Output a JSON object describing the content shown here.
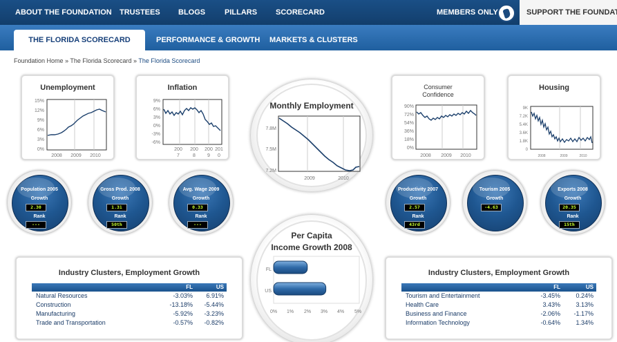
{
  "topnav": {
    "items": [
      "ABOUT THE FOUNDATION",
      "TRUSTEES",
      "BLOGS",
      "PILLARS",
      "SCORECARD"
    ],
    "members": "MEMBERS ONLY",
    "support": "SUPPORT THE FOUNDATION"
  },
  "subnav": {
    "tabs": [
      "THE FLORIDA SCORECARD",
      "PERFORMANCE & GROWTH",
      "MARKETS & CLUSTERS"
    ]
  },
  "breadcrumb": {
    "home": "Foundation Home",
    "sep": "»",
    "parent": "The Florida Scorecard",
    "current": "The Florida Scorecard"
  },
  "charts": {
    "unemployment": {
      "title": "Unemployment",
      "yticks": [
        "15%",
        "12%",
        "9%",
        "6%",
        "3%",
        "0%"
      ],
      "xticks": [
        "2008",
        "2009",
        "2010"
      ]
    },
    "inflation": {
      "title": "Inflation",
      "yticks": [
        "9%",
        "6%",
        "3%",
        "0%",
        "-3%",
        "-6%"
      ],
      "xticks": [
        [
          "200",
          "7"
        ],
        [
          "200",
          "8"
        ],
        [
          "200",
          "9"
        ],
        [
          "201",
          "0"
        ]
      ]
    },
    "monthly": {
      "title": "Monthly Employment",
      "yticks": [
        "7.8M",
        "7.5M",
        "7.2M"
      ],
      "xticks": [
        "2009",
        "2010"
      ]
    },
    "confidence": {
      "title_line1": "Consumer",
      "title_line2": "Confidence",
      "yticks": [
        "90%",
        "72%",
        "54%",
        "36%",
        "18%",
        "0%"
      ],
      "xticks": [
        "2008",
        "2009",
        "2010"
      ]
    },
    "housing": {
      "title": "Housing",
      "yticks": [
        "9K",
        "7.2K",
        "5.4K",
        "3.6K",
        "1.8K",
        "0"
      ],
      "xticks": [
        "2008",
        "2009",
        "2010"
      ]
    },
    "percapita": {
      "title_line1": "Per Capita",
      "title_line2": "Income Growth 2008",
      "categories": [
        "FL",
        "US"
      ],
      "values": [
        2.0,
        3.1
      ],
      "xticks": [
        "0%",
        "1%",
        "2%",
        "3%",
        "4%",
        "5%"
      ]
    }
  },
  "stats": [
    {
      "title": "Population 2005",
      "growth_label": "Growth",
      "growth": "2.30",
      "rank_label": "Rank",
      "rank": "---"
    },
    {
      "title": "Gross Prod. 2008",
      "growth_label": "Growth",
      "growth": "1.31",
      "rank_label": "Rank",
      "rank": "50th"
    },
    {
      "title": "Avg. Wage 2009",
      "growth_label": "Growth",
      "growth": "0.33",
      "rank_label": "Rank",
      "rank": "---"
    },
    {
      "title": "Productivity 2007",
      "growth_label": "Growth",
      "growth": "2.57",
      "rank_label": "Rank",
      "rank": "43rd"
    },
    {
      "title": "Tourism 2005",
      "growth_label": "Growth",
      "growth": "-4.63",
      "rank_label": "",
      "rank": ""
    },
    {
      "title": "Exports 2008",
      "growth_label": "Growth",
      "growth": "20.35",
      "rank_label": "Rank",
      "rank": "15th"
    }
  ],
  "clusters_left": {
    "title": "Industry Clusters, Employment Growth",
    "cols": [
      "FL",
      "US"
    ],
    "rows": [
      {
        "name": "Natural Resources",
        "fl": "-3.03%",
        "us": "6.91%"
      },
      {
        "name": "Construction",
        "fl": "-13.18%",
        "us": "-5.44%"
      },
      {
        "name": "Manufacturing",
        "fl": "-5.92%",
        "us": "-3.23%"
      },
      {
        "name": "Trade and Transportation",
        "fl": "-0.57%",
        "us": "-0.82%"
      }
    ]
  },
  "clusters_right": {
    "title": "Industry Clusters, Employment Growth",
    "cols": [
      "FL",
      "US"
    ],
    "rows": [
      {
        "name": "Tourism and Entertainment",
        "fl": "-3.45%",
        "us": "0.24%"
      },
      {
        "name": "Health Care",
        "fl": "3.43%",
        "us": "3.13%"
      },
      {
        "name": "Business and Finance",
        "fl": "-2.06%",
        "us": "-1.17%"
      },
      {
        "name": "Information Technology",
        "fl": "-0.64%",
        "us": "1.34%"
      }
    ]
  },
  "colors": {
    "nav": "#17457a",
    "subnav": "#2a6aad",
    "line": "#1b3f6b",
    "accent_green": "#c8ff2e"
  }
}
